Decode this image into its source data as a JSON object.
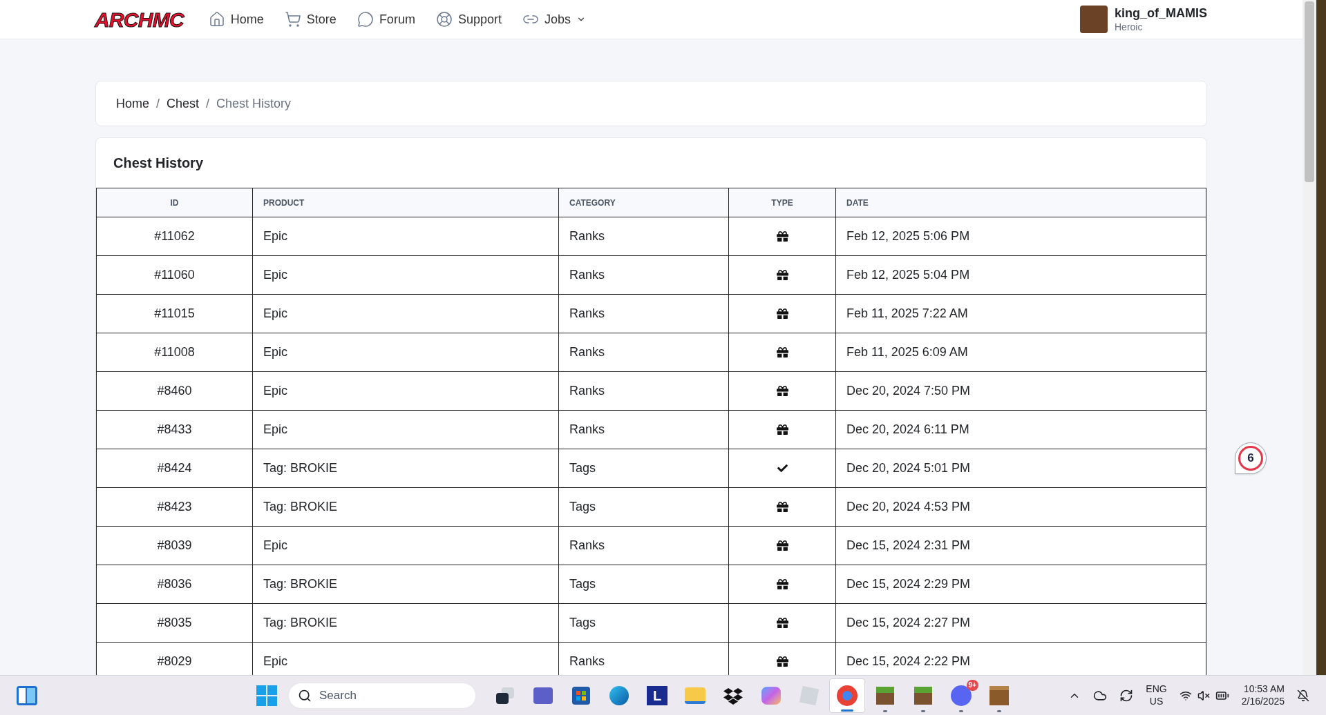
{
  "header": {
    "logo": "ARCHMC",
    "nav": [
      {
        "kind": "home",
        "label": "Home",
        "dropdown": false
      },
      {
        "kind": "cart",
        "label": "Store",
        "dropdown": false
      },
      {
        "kind": "chat",
        "label": "Forum",
        "dropdown": false
      },
      {
        "kind": "support",
        "label": "Support",
        "dropdown": false
      },
      {
        "kind": "link",
        "label": "Jobs",
        "dropdown": true
      }
    ],
    "user": {
      "name": "king_of_MAMIS",
      "rank": "Heroic"
    }
  },
  "breadcrumb": [
    {
      "label": "Home",
      "current": false
    },
    {
      "separator": "/",
      "label": "Chest",
      "current": false
    },
    {
      "separator": "/",
      "label": "Chest History",
      "current": true
    }
  ],
  "card_title": "Chest History",
  "table": {
    "columns": [
      "ID",
      "PRODUCT",
      "CATEGORY",
      "TYPE",
      "DATE"
    ],
    "rows": [
      {
        "id": "#11062",
        "product": "Epic",
        "category": "Ranks",
        "kind": "gift",
        "date": "Feb 12, 2025 5:06 PM"
      },
      {
        "id": "#11060",
        "product": "Epic",
        "category": "Ranks",
        "kind": "gift",
        "date": "Feb 12, 2025 5:04 PM"
      },
      {
        "id": "#11015",
        "product": "Epic",
        "category": "Ranks",
        "kind": "gift",
        "date": "Feb 11, 2025 7:22 AM"
      },
      {
        "id": "#11008",
        "product": "Epic",
        "category": "Ranks",
        "kind": "gift",
        "date": "Feb 11, 2025 6:09 AM"
      },
      {
        "id": "#8460",
        "product": "Epic",
        "category": "Ranks",
        "kind": "gift",
        "date": "Dec 20, 2024 7:50 PM"
      },
      {
        "id": "#8433",
        "product": "Epic",
        "category": "Ranks",
        "kind": "gift",
        "date": "Dec 20, 2024 6:11 PM"
      },
      {
        "id": "#8424",
        "product": "Tag: BROKIE",
        "category": "Tags",
        "kind": "check",
        "date": "Dec 20, 2024 5:01 PM"
      },
      {
        "id": "#8423",
        "product": "Tag: BROKIE",
        "category": "Tags",
        "kind": "gift",
        "date": "Dec 20, 2024 4:53 PM"
      },
      {
        "id": "#8039",
        "product": "Epic",
        "category": "Ranks",
        "kind": "gift",
        "date": "Dec 15, 2024 2:31 PM"
      },
      {
        "id": "#8036",
        "product": "Tag: BROKIE",
        "category": "Tags",
        "kind": "gift",
        "date": "Dec 15, 2024 2:29 PM"
      },
      {
        "id": "#8035",
        "product": "Tag: BROKIE",
        "category": "Tags",
        "kind": "gift",
        "date": "Dec 15, 2024 2:27 PM"
      },
      {
        "id": "#8029",
        "product": "Epic",
        "category": "Ranks",
        "kind": "gift",
        "date": "Dec 15, 2024 2:22 PM"
      }
    ]
  },
  "floating_badge": "6",
  "taskbar": {
    "search": {
      "placeholder": "Search"
    },
    "apps": [
      {
        "kind": "taskview",
        "selected": false,
        "running": false
      },
      {
        "kind": "teams",
        "selected": false,
        "running": false
      },
      {
        "kind": "store",
        "selected": false,
        "running": false
      },
      {
        "kind": "edge",
        "selected": false,
        "running": false
      },
      {
        "kind": "letter",
        "label": "L",
        "selected": false,
        "running": false
      },
      {
        "kind": "folder",
        "selected": false,
        "running": false
      },
      {
        "kind": "dropbox",
        "selected": false,
        "running": false
      },
      {
        "kind": "copilot",
        "selected": false,
        "running": false
      },
      {
        "kind": "roblox",
        "selected": false,
        "running": false
      },
      {
        "kind": "chrome",
        "selected": true,
        "running": true
      },
      {
        "kind": "grass",
        "selected": false,
        "running": true
      },
      {
        "kind": "grass",
        "selected": false,
        "running": true
      },
      {
        "kind": "discord",
        "badge": "9+",
        "selected": false,
        "running": true
      },
      {
        "kind": "crate",
        "selected": false,
        "running": true
      }
    ],
    "language": "ENG",
    "region": "US",
    "time": "10:53 AM",
    "date": "2/16/2025"
  }
}
